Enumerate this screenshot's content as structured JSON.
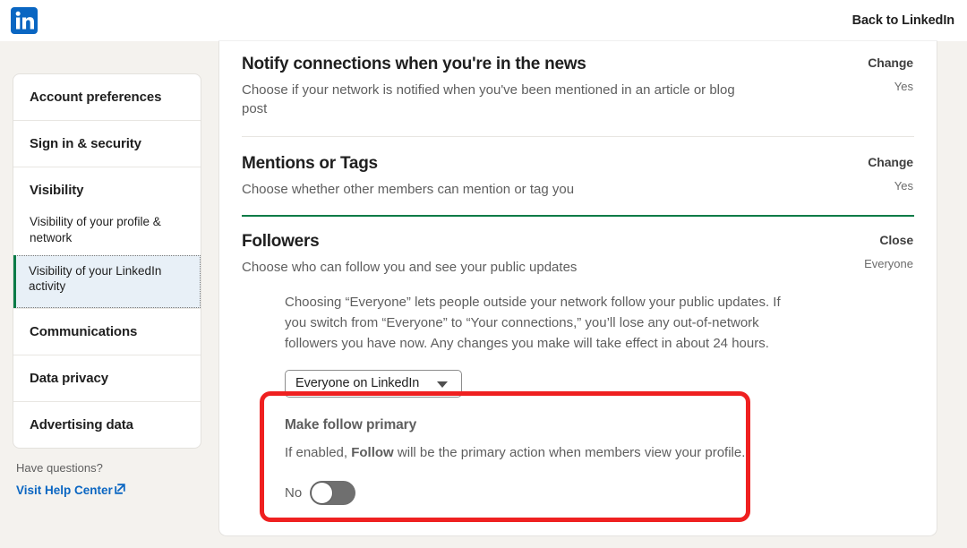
{
  "topbar": {
    "logo_icon": "linkedin-logo-icon",
    "back_label": "Back to LinkedIn",
    "logo_color": "#0a66c2"
  },
  "sidebar": {
    "items": [
      {
        "label": "Account preferences",
        "type": "link"
      },
      {
        "label": "Sign in & security",
        "type": "link"
      },
      {
        "label": "Visibility",
        "type": "group"
      },
      {
        "label": "Visibility of your profile & network",
        "type": "sub"
      },
      {
        "label": "Visibility of your LinkedIn activity",
        "type": "sub",
        "selected": true
      },
      {
        "label": "Communications",
        "type": "group"
      },
      {
        "label": "Data privacy",
        "type": "link"
      },
      {
        "label": "Advertising data",
        "type": "link"
      }
    ],
    "help": {
      "question": "Have questions?",
      "link_label": "Visit Help Center",
      "link_icon": "external-link-icon",
      "link_color": "#0a66c2"
    },
    "selected_accent": "#0a7b47"
  },
  "main": {
    "sections": [
      {
        "title": "Notify connections when you're in the news",
        "description": "Choose if your network is notified when you've been mentioned in an article or blog post",
        "action": "Change",
        "value": "Yes"
      },
      {
        "title": "Mentions or Tags",
        "description": "Choose whether other members can mention or tag you",
        "action": "Change",
        "value": "Yes"
      },
      {
        "title": "Followers",
        "description": "Choose who can follow you and see your public updates",
        "action": "Close",
        "value": "Everyone"
      }
    ],
    "followers_detail": {
      "explanation": "Choosing “Everyone” lets people outside your network follow your public updates. If you switch from “Everyone” to “Your connections,” you’ll lose any out-of-network followers you have now. Any changes you make will take effect in about 24 hours.",
      "select_value": "Everyone on LinkedIn",
      "select_icon": "chevron-down-icon",
      "sub_setting": {
        "title": "Make follow primary",
        "desc_before": "If enabled, ",
        "desc_bold": "Follow",
        "desc_after": " will be the primary action when members view your profile.",
        "toggle_label": "No",
        "toggle_state": "off"
      }
    },
    "divider_accent_color": "#0a7b47",
    "highlight_color": "#ef2020"
  }
}
